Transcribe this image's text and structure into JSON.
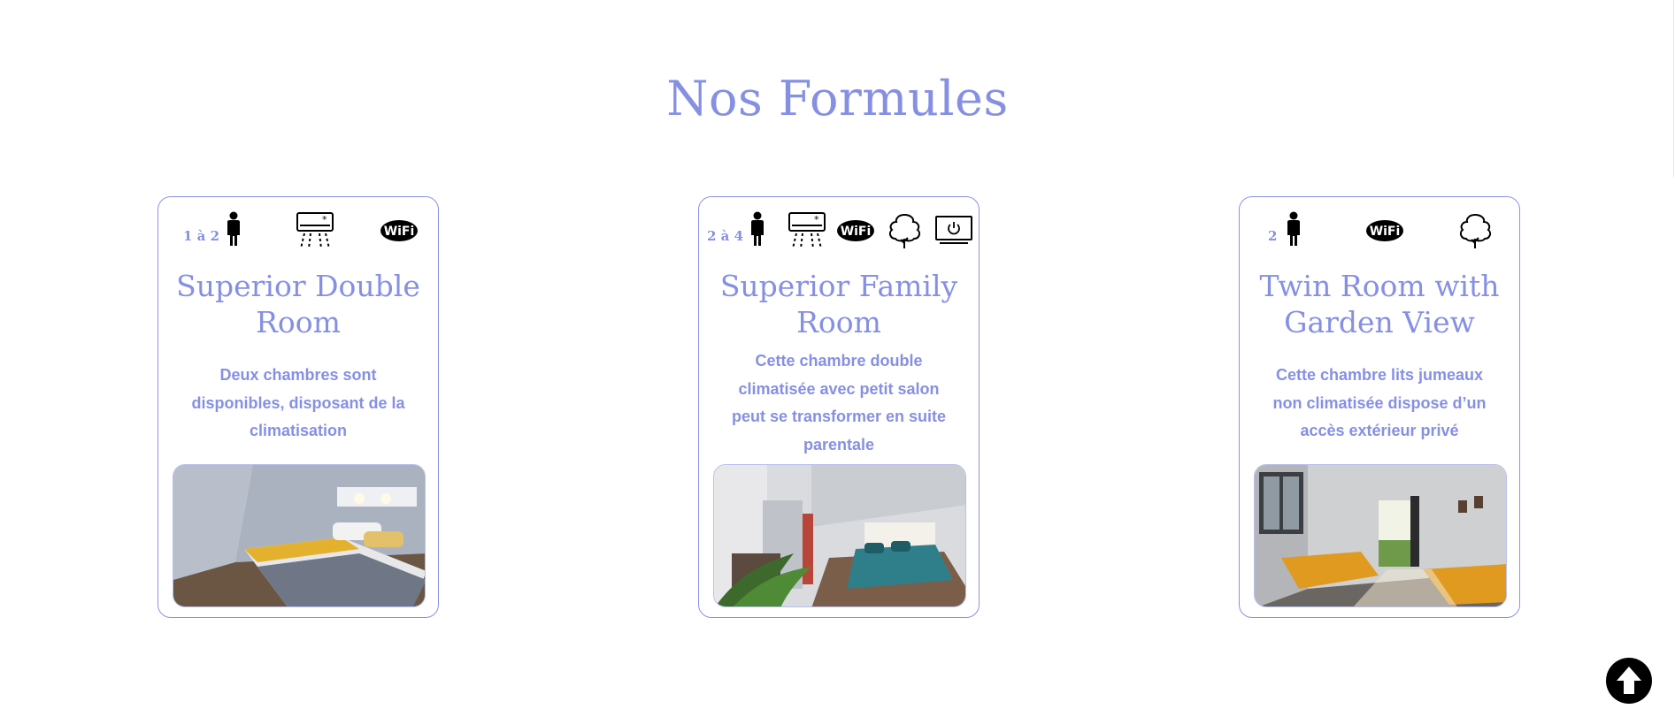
{
  "page": {
    "title": "Nos Formules"
  },
  "cards": [
    {
      "capacity": "1 à 2",
      "amenities": [
        "person-icon",
        "air-conditioner-icon",
        "wifi-icon"
      ],
      "title": "Superior Double Room",
      "description": "Deux chambres sont disponibles, disposant de la climatisation"
    },
    {
      "capacity": "2 à 4",
      "amenities": [
        "person-icon",
        "air-conditioner-icon",
        "wifi-icon",
        "tree-icon",
        "tv-icon"
      ],
      "title": "Superior Family Room",
      "description": "Cette chambre double climatisée avec petit salon peut se transformer en suite parentale"
    },
    {
      "capacity": "2",
      "amenities": [
        "person-icon",
        "wifi-icon",
        "tree-icon"
      ],
      "title": "Twin Room with Garden View",
      "description": "Cette chambre lits jumeaux non climatisée dispose d’un accès extérieur privé"
    }
  ],
  "scroll_top": {
    "icon": "arrow-up-icon"
  },
  "colors": {
    "accent": "#8690e3",
    "border": "#8a93e4"
  }
}
